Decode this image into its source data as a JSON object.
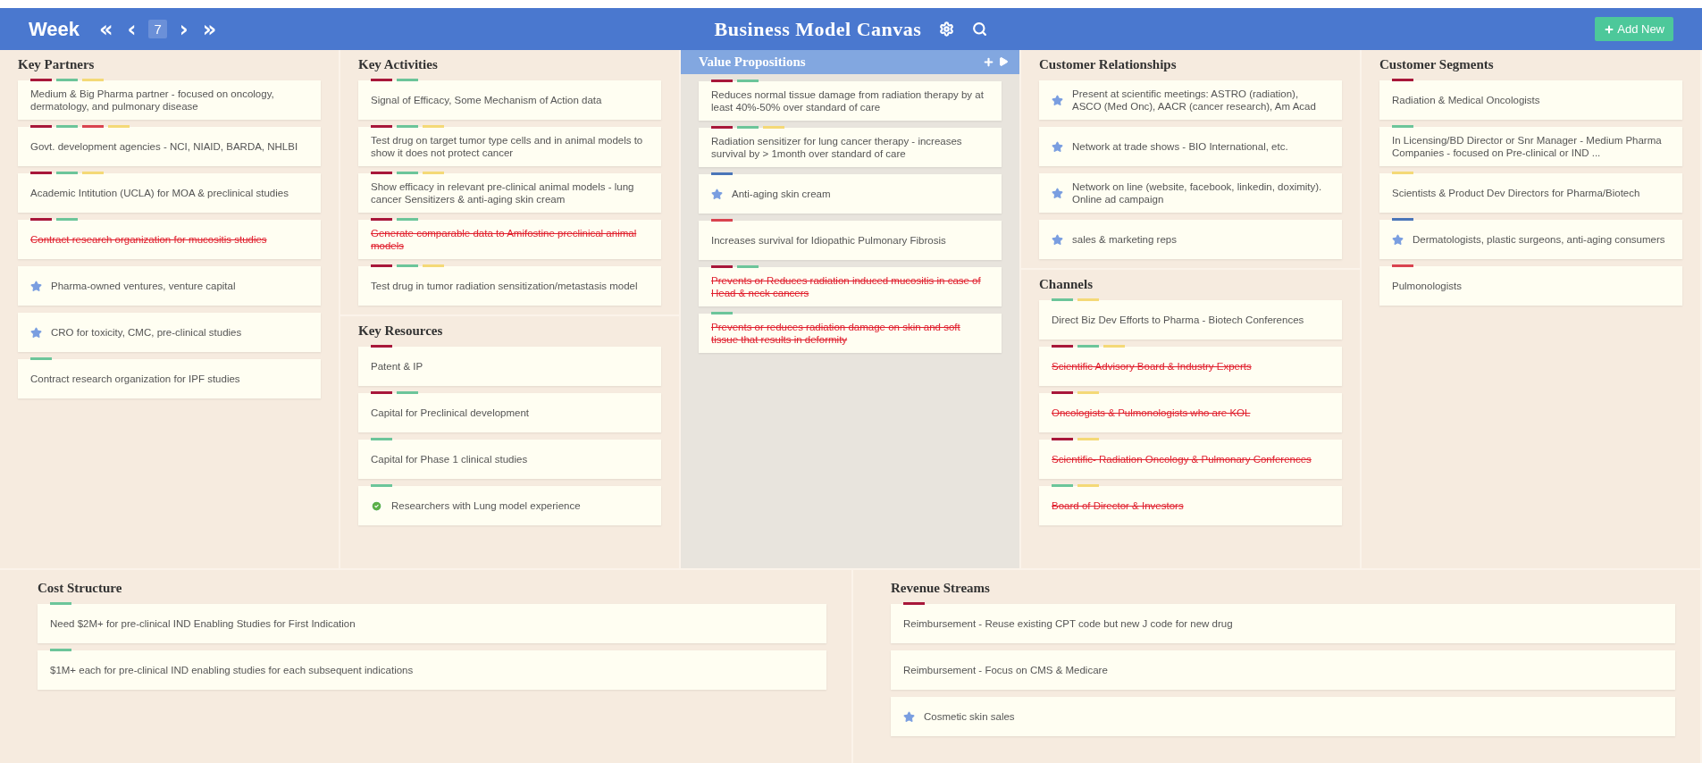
{
  "topbar": {
    "week_label": "Week",
    "first": "«",
    "prev": "‹",
    "week": "7",
    "next": "›",
    "last": "»",
    "title": "Business Model Canvas",
    "add_button": "Add New"
  },
  "columns": [
    {
      "sections": [
        {
          "title": "Key Partners",
          "selected": false,
          "items": [
            {
              "text": "Medium & Big Pharma partner - focused on oncology, dermatology, and pulmonary disease",
              "struck": false,
              "kind": "plain",
              "tags": [
                {
                  "color": "#a8173a"
                },
                {
                  "color": "#6cc59a"
                },
                {
                  "color": "#f4d977"
                }
              ]
            },
            {
              "text": "Govt. development agencies - NCI, NIAID, BARDA, NHLBI",
              "struck": false,
              "kind": "plain",
              "tags": [
                {
                  "color": "#a8173a"
                },
                {
                  "color": "#6cc59a"
                },
                {
                  "color": "#d9434f"
                },
                {
                  "color": "#f4d977"
                }
              ]
            },
            {
              "text": "Academic Intitution (UCLA) for MOA & preclinical studies",
              "struck": false,
              "kind": "plain",
              "tags": [
                {
                  "color": "#a8173a"
                },
                {
                  "color": "#6cc59a"
                },
                {
                  "color": "#f4d977"
                }
              ]
            },
            {
              "text": "Contract research organization for mucositis studies",
              "struck": true,
              "kind": "plain",
              "tags": [
                {
                  "color": "#a8173a"
                },
                {
                  "color": "#6cc59a"
                }
              ]
            },
            {
              "text": "Pharma-owned ventures, venture capital",
              "struck": false,
              "kind": "star"
            },
            {
              "text": "CRO for toxicity, CMC, pre-clinical studies",
              "struck": false,
              "kind": "star"
            },
            {
              "text": "Contract research organization for IPF studies",
              "struck": false,
              "kind": "plain",
              "tags": [
                {
                  "color": "#6cc59a"
                }
              ]
            }
          ]
        }
      ]
    },
    {
      "sections": [
        {
          "title": "Key Activities",
          "selected": false,
          "items": [
            {
              "text": "Signal of Efficacy, Some Mechanism of Action data",
              "struck": false,
              "kind": "plain",
              "tags": [
                {
                  "color": "#a8173a"
                },
                {
                  "color": "#6cc59a"
                }
              ]
            },
            {
              "text": "Test drug on target tumor type cells and in animal models to show it does not protect cancer",
              "struck": false,
              "kind": "plain",
              "tags": [
                {
                  "color": "#a8173a"
                },
                {
                  "color": "#6cc59a"
                },
                {
                  "color": "#f4d977"
                }
              ]
            },
            {
              "text": "Show efficacy in relevant pre-clinical animal models - lung cancer Sensitizers & anti-aging skin cream",
              "struck": false,
              "kind": "plain",
              "tags": [
                {
                  "color": "#a8173a"
                },
                {
                  "color": "#6cc59a"
                },
                {
                  "color": "#f4d977"
                }
              ]
            },
            {
              "text": "Generate comparable data to Amifostine preclinical animal models",
              "struck": true,
              "kind": "plain",
              "tags": [
                {
                  "color": "#a8173a"
                },
                {
                  "color": "#6cc59a"
                }
              ]
            },
            {
              "text": "Test drug in tumor radiation sensitization/metastasis model",
              "struck": false,
              "kind": "plain",
              "tags": [
                {
                  "color": "#a8173a"
                },
                {
                  "color": "#6cc59a"
                },
                {
                  "color": "#f4d977"
                }
              ]
            }
          ]
        },
        {
          "title": "Key Resources",
          "selected": false,
          "items": [
            {
              "text": "Patent & IP",
              "struck": false,
              "kind": "plain",
              "tags": [
                {
                  "color": "#a8173a"
                }
              ]
            },
            {
              "text": "Capital for Preclinical development",
              "struck": false,
              "kind": "plain",
              "tags": [
                {
                  "color": "#a8173a"
                },
                {
                  "color": "#6cc59a"
                }
              ]
            },
            {
              "text": "Capital for Phase 1 clinical studies",
              "struck": false,
              "kind": "plain",
              "tags": [
                {
                  "color": "#6cc59a"
                }
              ]
            },
            {
              "text": "Researchers with Lung model experience",
              "struck": false,
              "kind": "check",
              "tags": [
                {
                  "color": "#6cc59a"
                }
              ]
            }
          ]
        }
      ]
    },
    {
      "sections": [
        {
          "title": "Value Propositions",
          "selected": true,
          "items": [
            {
              "text": "Reduces normal tissue damage from radiation therapy by at least 40%-50% over standard of care",
              "struck": false,
              "kind": "plain",
              "tags": [
                {
                  "color": "#a8173a"
                },
                {
                  "color": "#6cc59a"
                }
              ]
            },
            {
              "text": "Radiation sensitizer for lung cancer therapy - increases survival by > 1month over standard of care",
              "struck": false,
              "kind": "plain",
              "tags": [
                {
                  "color": "#a8173a"
                },
                {
                  "color": "#6cc59a"
                },
                {
                  "color": "#f4d977"
                }
              ]
            },
            {
              "text": "Anti-aging skin cream",
              "struck": false,
              "kind": "star",
              "tags": [
                {
                  "color": "#4a75b8"
                }
              ]
            },
            {
              "text": "Increases survival for Idiopathic Pulmonary Fibrosis",
              "struck": false,
              "kind": "plain",
              "tags": [
                {
                  "color": "#d9434f"
                }
              ]
            },
            {
              "text": "Prevents or Reduces radiation induced mucositis in case of Head & neck cancers",
              "struck": true,
              "kind": "plain",
              "tags": [
                {
                  "color": "#a8173a"
                },
                {
                  "color": "#6cc59a"
                }
              ]
            },
            {
              "text": "Prevents or reduces radiation damage on skin and soft tissue that results in deformity",
              "struck": true,
              "kind": "plain",
              "tags": [
                {
                  "color": "#6cc59a"
                }
              ]
            }
          ]
        }
      ]
    },
    {
      "sections": [
        {
          "title": "Customer Relationships",
          "selected": false,
          "items": [
            {
              "text": "Present at scientific meetings: ASTRO (radiation), ASCO (Med Onc), AACR (cancer research), Am Acad",
              "struck": false,
              "kind": "star"
            },
            {
              "text": "Network at trade shows - BIO International, etc.",
              "struck": false,
              "kind": "star"
            },
            {
              "text": "Network on line (website, facebook, linkedin, doximity). Online ad campaign",
              "struck": false,
              "kind": "star"
            },
            {
              "text": "sales & marketing reps",
              "struck": false,
              "kind": "star"
            }
          ]
        },
        {
          "title": "Channels",
          "selected": false,
          "items": [
            {
              "text": "Direct Biz Dev Efforts to Pharma - Biotech Conferences",
              "struck": false,
              "kind": "plain",
              "tags": [
                {
                  "color": "#6cc59a"
                },
                {
                  "color": "#f4d977"
                }
              ]
            },
            {
              "text": "Scientific Advisory Board & Industry Experts",
              "struck": true,
              "kind": "plain",
              "tags": [
                {
                  "color": "#a8173a"
                },
                {
                  "color": "#6cc59a"
                },
                {
                  "color": "#f4d977"
                }
              ]
            },
            {
              "text": "Oncologists & Pulmonologists who are KOL",
              "struck": true,
              "kind": "plain",
              "tags": [
                {
                  "color": "#a8173a"
                },
                {
                  "color": "#f4d977"
                }
              ]
            },
            {
              "text": "Scientific- Radiation Oncology & Pulmonary Conferences",
              "struck": true,
              "kind": "plain",
              "tags": [
                {
                  "color": "#a8173a"
                },
                {
                  "color": "#f4d977"
                }
              ]
            },
            {
              "text": "Board of Director & Investors",
              "struck": true,
              "kind": "plain",
              "tags": [
                {
                  "color": "#6cc59a"
                },
                {
                  "color": "#f4d977"
                }
              ]
            }
          ]
        }
      ]
    },
    {
      "sections": [
        {
          "title": "Customer Segments",
          "selected": false,
          "items": [
            {
              "text": "Radiation & Medical Oncologists",
              "struck": false,
              "kind": "plain",
              "tags": [
                {
                  "color": "#a8173a"
                }
              ]
            },
            {
              "text": "In Licensing/BD Director or Snr Manager - Medium Pharma Companies - focused on Pre-clinical or IND ...",
              "struck": false,
              "kind": "plain",
              "tags": [
                {
                  "color": "#6cc59a"
                }
              ]
            },
            {
              "text": "Scientists & Product Dev Directors for Pharma/Biotech",
              "struck": false,
              "kind": "plain",
              "tags": [
                {
                  "color": "#f4d977"
                }
              ]
            },
            {
              "text": "Dermatologists, plastic surgeons, anti-aging consumers",
              "struck": false,
              "kind": "star",
              "tags": [
                {
                  "color": "#4a75b8"
                }
              ]
            },
            {
              "text": "Pulmonologists",
              "struck": false,
              "kind": "plain",
              "tags": [
                {
                  "color": "#d9434f"
                }
              ]
            }
          ]
        }
      ]
    }
  ],
  "bottom_sections": [
    {
      "title": "Cost Structure",
      "selected": false,
      "items": [
        {
          "text": "Need $2M+ for pre-clinical IND Enabling Studies for First Indication",
          "struck": false,
          "kind": "plain",
          "tags": [
            {
              "color": "#6cc59a"
            }
          ]
        },
        {
          "text": "$1M+ each for pre-clinical IND enabling studies for each subsequent indications",
          "struck": false,
          "kind": "plain",
          "tags": [
            {
              "color": "#6cc59a"
            }
          ]
        }
      ]
    },
    {
      "title": "Revenue Streams",
      "selected": false,
      "items": [
        {
          "text": "Reimbursement - Reuse existing CPT code but new J code for new drug",
          "struck": false,
          "kind": "plain",
          "tags": [
            {
              "color": "#a8173a"
            }
          ]
        },
        {
          "text": "Reimbursement - Focus on CMS & Medicare",
          "struck": false,
          "kind": "plain"
        },
        {
          "text": "Cosmetic skin sales",
          "struck": false,
          "kind": "star"
        }
      ]
    }
  ]
}
